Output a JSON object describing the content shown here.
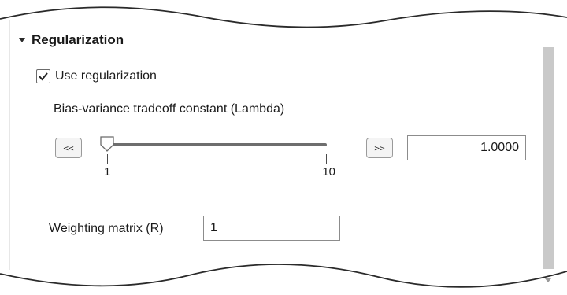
{
  "regularization": {
    "title": "Regularization",
    "use_checkbox": {
      "label": "Use regularization",
      "checked": true
    },
    "lambda": {
      "label": "Bias-variance tradeoff constant (Lambda)",
      "decrease_label": "<<",
      "increase_label": ">>",
      "min_label": "1",
      "max_label": "10",
      "value": "1.0000"
    },
    "weighting": {
      "label": "Weighting matrix (R)",
      "value": "1"
    }
  },
  "icons": {
    "caret": "caret-down-icon",
    "check": "checkmark-icon",
    "slider_thumb": "slider-thumb-icon",
    "scroll_arrow": "chevron-down-icon"
  }
}
